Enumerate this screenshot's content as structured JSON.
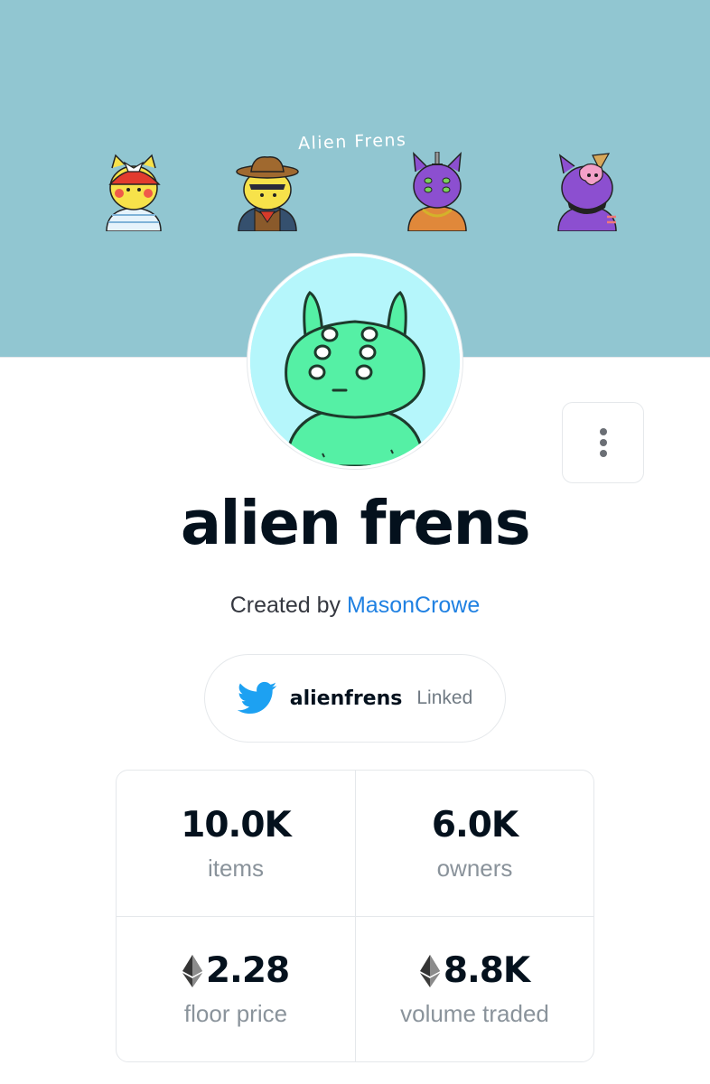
{
  "banner": {
    "title": "Alien Frens",
    "background_color": "#91c6d1",
    "thumbnails": [
      "yellow-alien-red-cap",
      "yellow-alien-cowboy",
      "purple-alien-gold-chain",
      "purple-alien-ice-cream"
    ]
  },
  "collection": {
    "name": "alien frens",
    "created_by_label": "Created by",
    "creator": "MasonCrowe",
    "avatar_icon": "green-alien-avatar"
  },
  "more_menu": {
    "icon": "more-vertical-icon"
  },
  "social": {
    "icon": "twitter-bird-icon",
    "handle": "alienfrens",
    "status": "Linked"
  },
  "stats": {
    "items": {
      "value": "10.0K",
      "label": "items"
    },
    "owners": {
      "value": "6.0K",
      "label": "owners"
    },
    "floor_price": {
      "value": "2.28",
      "label": "floor price",
      "currency_icon": "ethereum-icon"
    },
    "volume_traded": {
      "value": "8.8K",
      "label": "volume traded",
      "currency_icon": "ethereum-icon"
    }
  },
  "colors": {
    "accent": "#2081e2",
    "text": "#04111d",
    "muted": "#8a939b",
    "twitter": "#1da1f2"
  }
}
